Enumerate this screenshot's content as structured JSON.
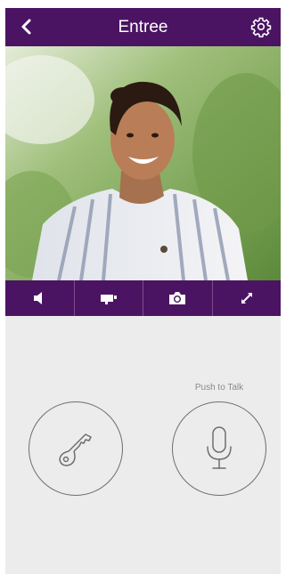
{
  "header": {
    "title": "Entree",
    "back_icon": "chevron-left-icon",
    "settings_icon": "gear-icon"
  },
  "video": {
    "description_icon": "live-video-feed"
  },
  "toolbar": {
    "items": [
      {
        "icon": "speaker-icon"
      },
      {
        "icon": "camera-record-icon"
      },
      {
        "icon": "photo-camera-icon"
      },
      {
        "icon": "fullscreen-icon"
      }
    ]
  },
  "controls": {
    "push_to_talk_label": "Push to Talk",
    "unlock_icon": "key-icon",
    "talk_icon": "microphone-icon"
  },
  "colors": {
    "brand": "#4b1463",
    "background": "#ececec",
    "outline": "#6e6e6e"
  }
}
